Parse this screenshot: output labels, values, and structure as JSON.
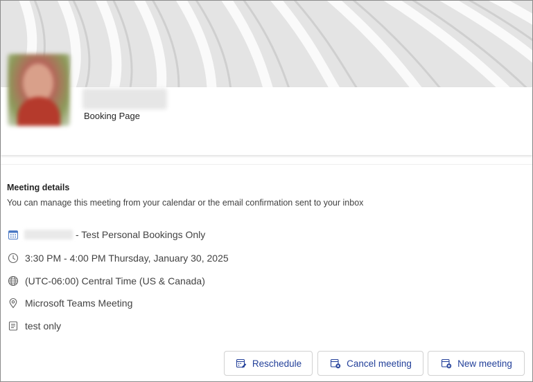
{
  "header": {
    "name_redacted": "",
    "booking_label": "Booking Page"
  },
  "meeting": {
    "title": "Meeting details",
    "subtitle": "You can manage this meeting from your calendar or the email confirmation sent to your inbox",
    "service": "- Test Personal Bookings Only",
    "time": "3:30 PM - 4:00 PM Thursday, January 30, 2025",
    "timezone": "(UTC-06:00) Central Time (US & Canada)",
    "location": "Microsoft Teams Meeting",
    "notes": "test only"
  },
  "actions": {
    "reschedule": "Reschedule",
    "cancel": "Cancel meeting",
    "new": "New meeting"
  },
  "icons": {
    "service": "calendar-icon",
    "time": "clock-icon",
    "timezone": "globe-icon",
    "location": "location-pin-icon",
    "notes": "notes-icon",
    "reschedule": "calendar-edit-icon",
    "cancel": "calendar-cancel-icon",
    "new": "calendar-add-icon"
  },
  "colors": {
    "accent": "#23409a",
    "text": "#242424",
    "muted": "#424242",
    "border": "#d1d1d1"
  }
}
